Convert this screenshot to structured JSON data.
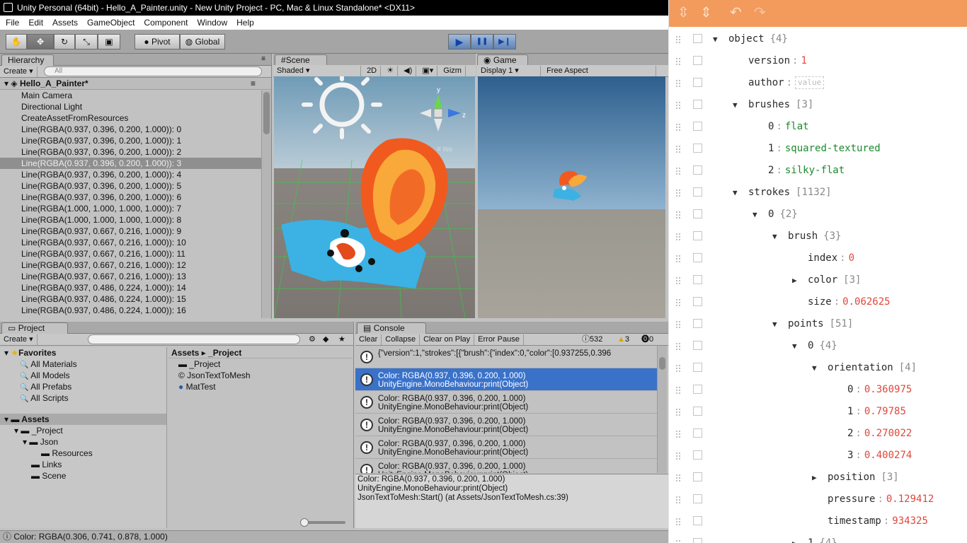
{
  "window": {
    "title": "Unity Personal (64bit) - Hello_A_Painter.unity - New Unity Project - PC, Mac & Linux Standalone* <DX11>"
  },
  "menu": [
    "File",
    "Edit",
    "Assets",
    "GameObject",
    "Component",
    "Window",
    "Help"
  ],
  "toolbar": {
    "pivot": "Pivot",
    "global": "Global",
    "play": "▶",
    "pause": "❚❚",
    "step": "▶❙"
  },
  "hierarchy": {
    "tab": "Hierarchy",
    "create": "Create",
    "search_placeholder": "All",
    "scene_name": "Hello_A_Painter*",
    "items": [
      "Main Camera",
      "Directional Light",
      "CreateAssetFromResources",
      "Line(RGBA(0.937, 0.396, 0.200, 1.000)): 0",
      "Line(RGBA(0.937, 0.396, 0.200, 1.000)): 1",
      "Line(RGBA(0.937, 0.396, 0.200, 1.000)): 2",
      "Line(RGBA(0.937, 0.396, 0.200, 1.000)): 3",
      "Line(RGBA(0.937, 0.396, 0.200, 1.000)): 4",
      "Line(RGBA(0.937, 0.396, 0.200, 1.000)): 5",
      "Line(RGBA(0.937, 0.396, 0.200, 1.000)): 6",
      "Line(RGBA(1.000, 1.000, 1.000, 1.000)): 7",
      "Line(RGBA(1.000, 1.000, 1.000, 1.000)): 8",
      "Line(RGBA(0.937, 0.667, 0.216, 1.000)): 9",
      "Line(RGBA(0.937, 0.667, 0.216, 1.000)): 10",
      "Line(RGBA(0.937, 0.667, 0.216, 1.000)): 11",
      "Line(RGBA(0.937, 0.667, 0.216, 1.000)): 12",
      "Line(RGBA(0.937, 0.667, 0.216, 1.000)): 13",
      "Line(RGBA(0.937, 0.486, 0.224, 1.000)): 14",
      "Line(RGBA(0.937, 0.486, 0.224, 1.000)): 15",
      "Line(RGBA(0.937, 0.486, 0.224, 1.000)): 16"
    ],
    "selected_index": 6
  },
  "scene": {
    "tab": "Scene",
    "shading": "Shaded",
    "mode2d": "2D",
    "gizmos": "Gizm",
    "persp": "Iso"
  },
  "game": {
    "tab": "Game",
    "display": "Display 1",
    "aspect": "Free Aspect"
  },
  "project": {
    "tab": "Project",
    "create": "Create",
    "favorites_label": "Favorites",
    "favorites": [
      "All Materials",
      "All Models",
      "All Prefabs",
      "All Scripts"
    ],
    "assets_label": "Assets",
    "tree": [
      "_Project",
      "Json",
      "Resources",
      "Links",
      "Scene"
    ],
    "breadcrumb": "Assets ▸ _Project",
    "files": [
      "_Project",
      "JsonTextToMesh",
      "MatTest"
    ]
  },
  "console": {
    "tab": "Console",
    "buttons": [
      "Clear",
      "Collapse",
      "Clear on Play",
      "Error Pause"
    ],
    "counts": {
      "log": "532",
      "warn": "3",
      "error": "0"
    },
    "rows": [
      {
        "line1": "{\"version\":1,\"strokes\":[{\"brush\":{\"index\":0,\"color\":[0.937255,0.396",
        "line2": ""
      },
      {
        "line1": "Color: RGBA(0.937, 0.396, 0.200, 1.000)",
        "line2": "UnityEngine.MonoBehaviour:print(Object)"
      },
      {
        "line1": "Color: RGBA(0.937, 0.396, 0.200, 1.000)",
        "line2": "UnityEngine.MonoBehaviour:print(Object)"
      },
      {
        "line1": "Color: RGBA(0.937, 0.396, 0.200, 1.000)",
        "line2": "UnityEngine.MonoBehaviour:print(Object)"
      },
      {
        "line1": "Color: RGBA(0.937, 0.396, 0.200, 1.000)",
        "line2": "UnityEngine.MonoBehaviour:print(Object)"
      },
      {
        "line1": "Color: RGBA(0.937, 0.396, 0.200, 1.000)",
        "line2": "UnityEngine.MonoBehaviour:print(Object)"
      }
    ],
    "selected_index": 1,
    "detail": [
      "Color: RGBA(0.937, 0.396, 0.200, 1.000)",
      "UnityEngine.MonoBehaviour:print(Object)",
      "JsonTextToMesh:Start() (at Assets/JsonTextToMesh.cs:39)"
    ]
  },
  "status": {
    "text": "Color: RGBA(0.306, 0.741, 0.878, 1.000)"
  },
  "jsonviewer": {
    "accent": "#f29b5d",
    "rows": [
      {
        "indent": 0,
        "arrow": "down",
        "key": "object",
        "meta": "{4}",
        "value": "",
        "vtype": ""
      },
      {
        "indent": 1,
        "arrow": "",
        "key": "version",
        "meta": "",
        "value": "1",
        "vtype": "num"
      },
      {
        "indent": 1,
        "arrow": "",
        "key": "author",
        "meta": "",
        "value": "value",
        "vtype": "placeholder"
      },
      {
        "indent": 1,
        "arrow": "down",
        "key": "brushes",
        "meta": "[3]",
        "value": "",
        "vtype": ""
      },
      {
        "indent": 2,
        "arrow": "",
        "key": "0",
        "meta": "",
        "value": "flat",
        "vtype": "str"
      },
      {
        "indent": 2,
        "arrow": "",
        "key": "1",
        "meta": "",
        "value": "squared-textured",
        "vtype": "str"
      },
      {
        "indent": 2,
        "arrow": "",
        "key": "2",
        "meta": "",
        "value": "silky-flat",
        "vtype": "str"
      },
      {
        "indent": 1,
        "arrow": "down",
        "key": "strokes",
        "meta": "[1132]",
        "value": "",
        "vtype": ""
      },
      {
        "indent": 2,
        "arrow": "down",
        "key": "0",
        "meta": "{2}",
        "value": "",
        "vtype": ""
      },
      {
        "indent": 3,
        "arrow": "down",
        "key": "brush",
        "meta": "{3}",
        "value": "",
        "vtype": ""
      },
      {
        "indent": 4,
        "arrow": "",
        "key": "index",
        "meta": "",
        "value": "0",
        "vtype": "num"
      },
      {
        "indent": 4,
        "arrow": "right",
        "key": "color",
        "meta": "[3]",
        "value": "",
        "vtype": ""
      },
      {
        "indent": 4,
        "arrow": "",
        "key": "size",
        "meta": "",
        "value": "0.062625",
        "vtype": "num"
      },
      {
        "indent": 3,
        "arrow": "down",
        "key": "points",
        "meta": "[51]",
        "value": "",
        "vtype": ""
      },
      {
        "indent": 4,
        "arrow": "down",
        "key": "0",
        "meta": "{4}",
        "value": "",
        "vtype": ""
      },
      {
        "indent": 5,
        "arrow": "down",
        "key": "orientation",
        "meta": "[4]",
        "value": "",
        "vtype": ""
      },
      {
        "indent": 6,
        "arrow": "",
        "key": "0",
        "meta": "",
        "value": "0.360975",
        "vtype": "num"
      },
      {
        "indent": 6,
        "arrow": "",
        "key": "1",
        "meta": "",
        "value": "0.79785",
        "vtype": "num"
      },
      {
        "indent": 6,
        "arrow": "",
        "key": "2",
        "meta": "",
        "value": "0.270022",
        "vtype": "num"
      },
      {
        "indent": 6,
        "arrow": "",
        "key": "3",
        "meta": "",
        "value": "0.400274",
        "vtype": "num"
      },
      {
        "indent": 5,
        "arrow": "right",
        "key": "position",
        "meta": "[3]",
        "value": "",
        "vtype": ""
      },
      {
        "indent": 5,
        "arrow": "",
        "key": "pressure",
        "meta": "",
        "value": "0.129412",
        "vtype": "num"
      },
      {
        "indent": 5,
        "arrow": "",
        "key": "timestamp",
        "meta": "",
        "value": "934325",
        "vtype": "num"
      },
      {
        "indent": 4,
        "arrow": "right",
        "key": "1",
        "meta": "{4}",
        "value": "",
        "vtype": ""
      }
    ]
  }
}
